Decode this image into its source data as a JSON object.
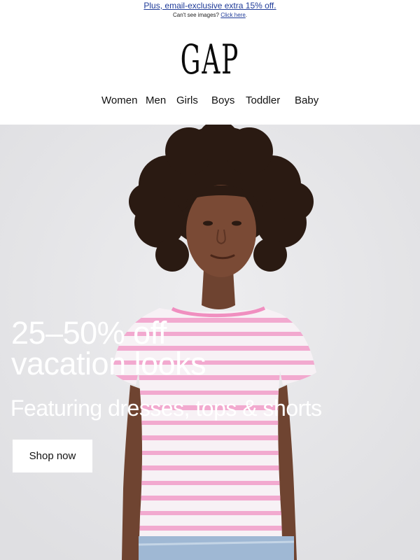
{
  "promo": {
    "headline": "Plus, email-exclusive extra 15% off.",
    "sub_text": "Can't see images? ",
    "sub_link": "Click here",
    "sub_end": "."
  },
  "logo": {
    "text": "GAP"
  },
  "nav": {
    "items": [
      {
        "label": "Women"
      },
      {
        "label": "Men"
      },
      {
        "label": "Girls"
      },
      {
        "label": "Boys"
      },
      {
        "label": "Toddler"
      },
      {
        "label": "Baby"
      }
    ]
  },
  "hero": {
    "title_line1": "25–50% off",
    "title_line2": "vacation looks",
    "subtitle": "Featuring dresses, tops & shorts",
    "cta_label": "Shop now",
    "image": "girl-in-pink-striped-tee-photo"
  },
  "colors": {
    "background": "#ffffff",
    "hero_bg": "#e7e7e9",
    "link": "#1f3b99",
    "hero_text": "#ffffff",
    "stripe_pink": "#f2a9cf"
  }
}
